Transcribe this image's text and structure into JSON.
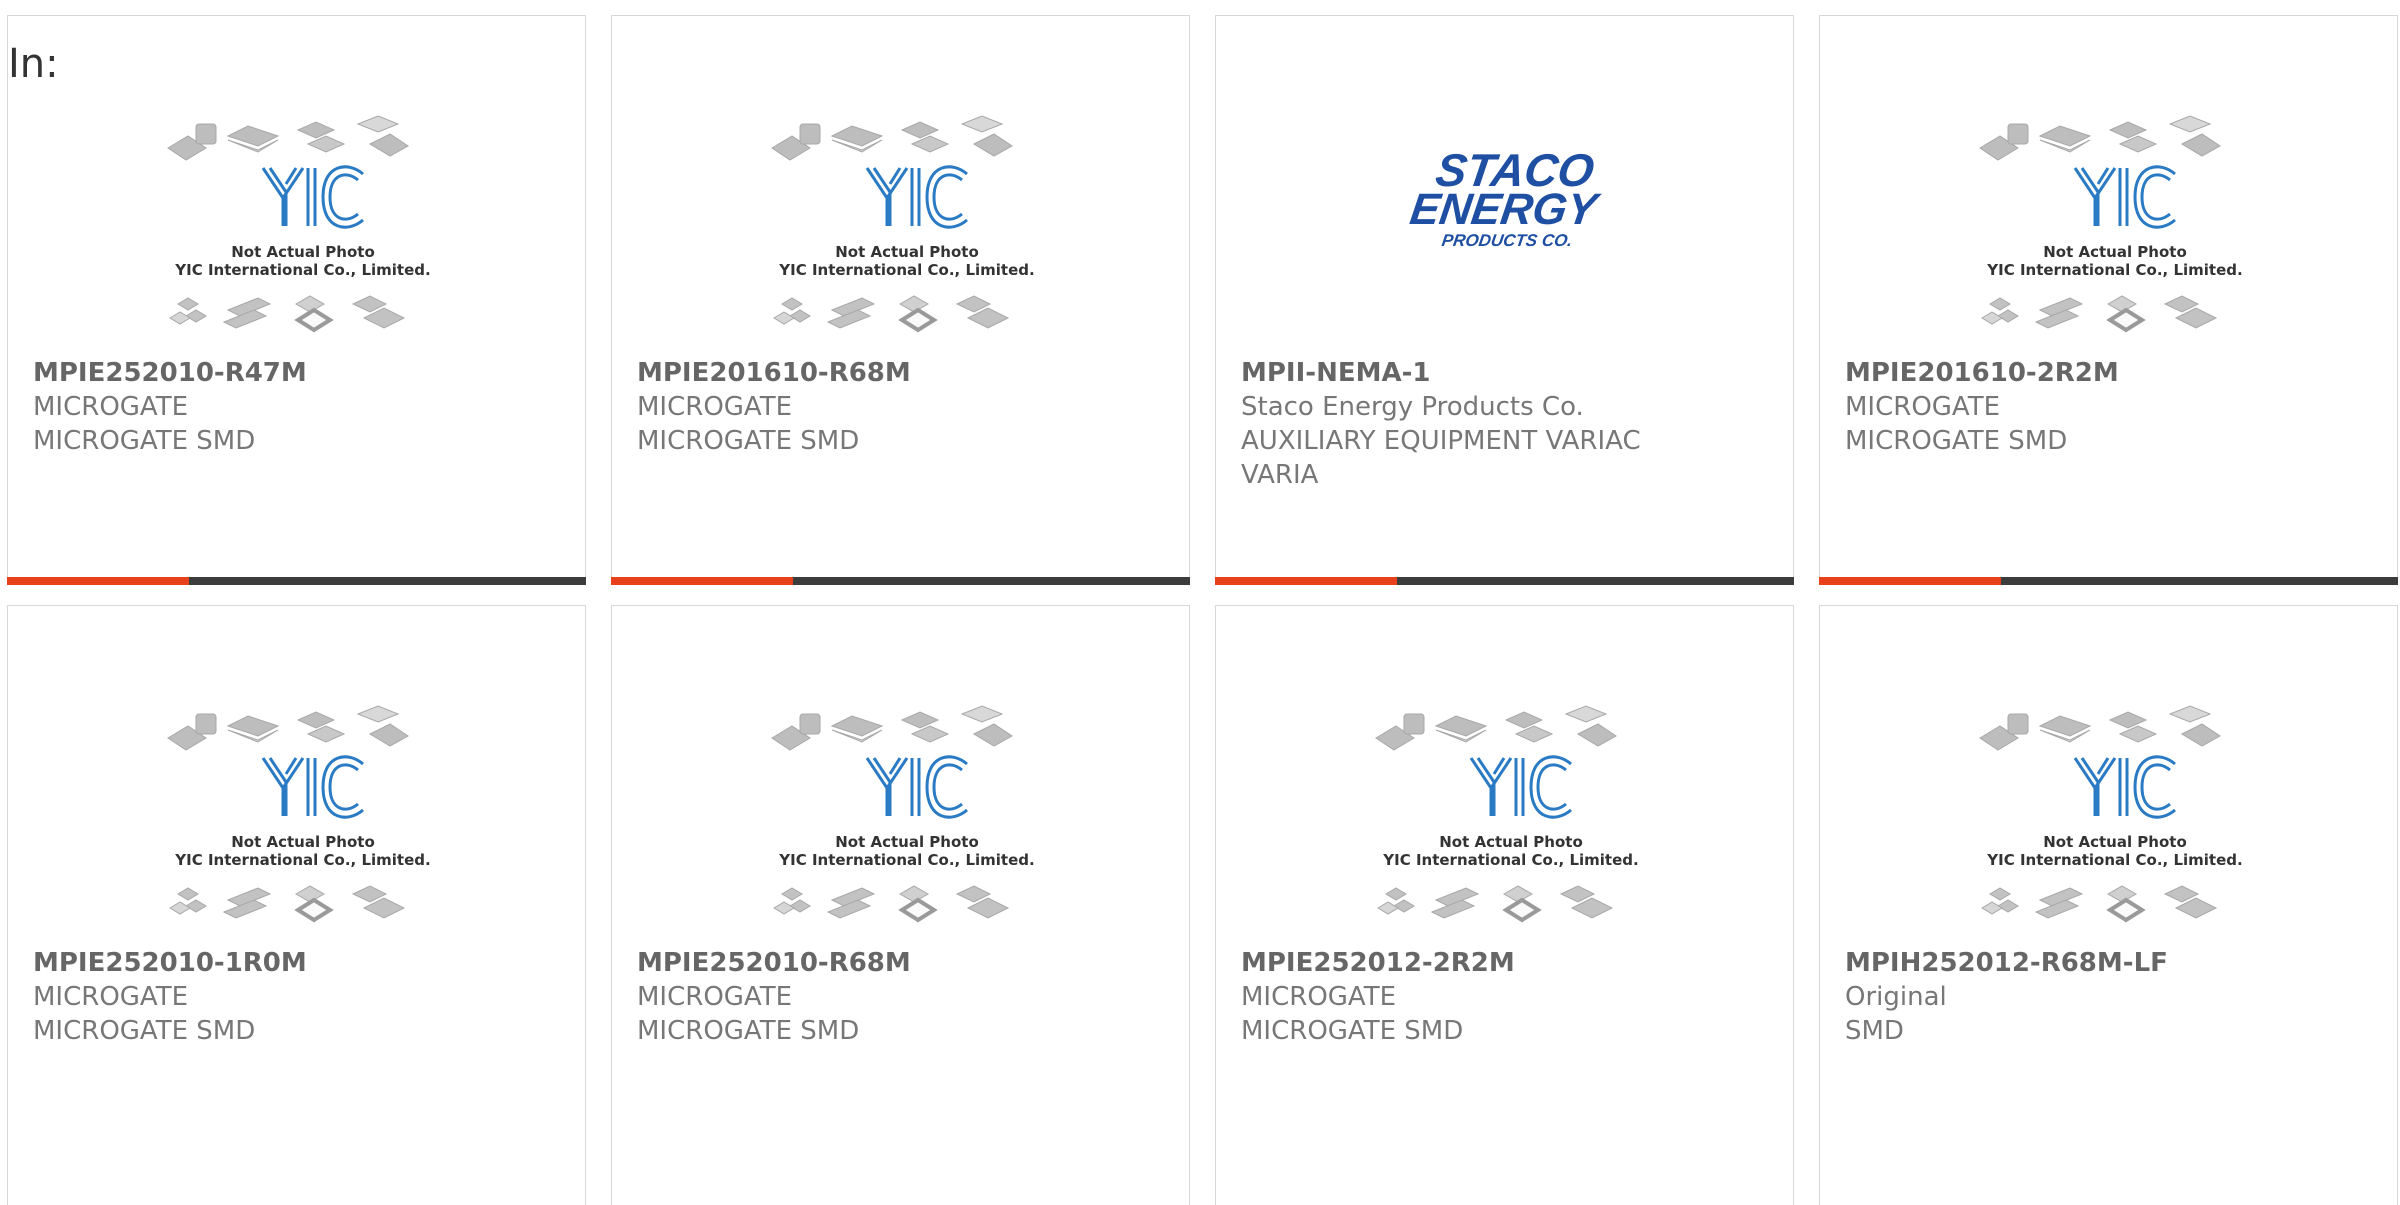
{
  "filter_label": "In:",
  "placeholder_caption": [
    "Not Actual Photo",
    "YIC International Co., Limited."
  ],
  "staco_logo": [
    "STACO",
    "ENERGY",
    "PRODUCTS CO."
  ],
  "colors": {
    "accent": "#e8401a",
    "bar": "#3c3c3c",
    "logo_blue": "#1f4fa3",
    "yic_blue": "#2a7bc4"
  },
  "products": [
    {
      "part": "MPIE252010-R47M",
      "maker": "MICROGATE",
      "desc": "MICROGATE SMD",
      "desc2": "",
      "image": "yic-placeholder"
    },
    {
      "part": "MPIE201610-R68M",
      "maker": "MICROGATE",
      "desc": "MICROGATE SMD",
      "desc2": "",
      "image": "yic-placeholder"
    },
    {
      "part": "MPII-NEMA-1",
      "maker": "Staco Energy Products Co.",
      "desc": "AUXILIARY EQUIPMENT VARIAC",
      "desc2": "VARIA",
      "image": "staco-logo"
    },
    {
      "part": "MPIE201610-2R2M",
      "maker": "MICROGATE",
      "desc": "MICROGATE SMD",
      "desc2": "",
      "image": "yic-placeholder"
    },
    {
      "part": "MPIE252010-1R0M",
      "maker": "MICROGATE",
      "desc": "MICROGATE SMD",
      "desc2": "",
      "image": "yic-placeholder"
    },
    {
      "part": "MPIE252010-R68M",
      "maker": "MICROGATE",
      "desc": "MICROGATE SMD",
      "desc2": "",
      "image": "yic-placeholder"
    },
    {
      "part": "MPIE252012-2R2M",
      "maker": "MICROGATE",
      "desc": "MICROGATE SMD",
      "desc2": "",
      "image": "yic-placeholder"
    },
    {
      "part": "MPIH252012-R68M-LF",
      "maker": "Original",
      "desc": "SMD",
      "desc2": "",
      "image": "yic-placeholder"
    }
  ]
}
